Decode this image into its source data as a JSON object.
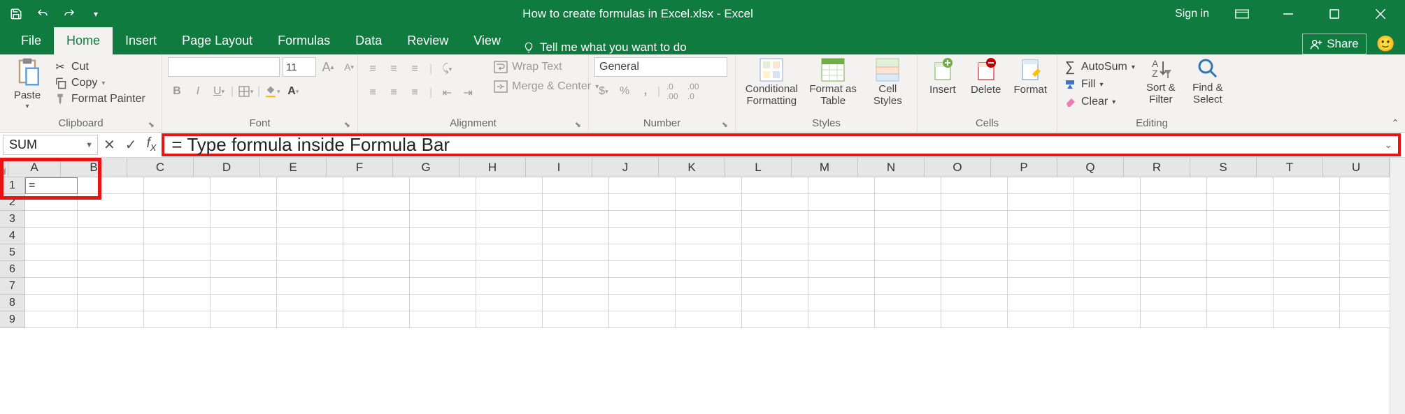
{
  "titlebar": {
    "title": "How to create formulas in Excel.xlsx - Excel",
    "signin": "Sign in"
  },
  "tabs": {
    "file": "File",
    "home": "Home",
    "insert": "Insert",
    "page_layout": "Page Layout",
    "formulas": "Formulas",
    "data": "Data",
    "review": "Review",
    "view": "View",
    "tell_me": "Tell me what you want to do",
    "share": "Share"
  },
  "ribbon": {
    "clipboard": {
      "label": "Clipboard",
      "paste": "Paste",
      "cut": "Cut",
      "copy": "Copy",
      "format_painter": "Format Painter"
    },
    "font": {
      "label": "Font",
      "font_name": "",
      "font_size": "11"
    },
    "alignment": {
      "label": "Alignment",
      "wrap": "Wrap Text",
      "merge": "Merge & Center"
    },
    "number": {
      "label": "Number",
      "format": "General"
    },
    "styles": {
      "label": "Styles",
      "conditional": "Conditional\nFormatting",
      "format_as": "Format as\nTable",
      "cell_styles": "Cell\nStyles"
    },
    "cells": {
      "label": "Cells",
      "insert": "Insert",
      "delete": "Delete",
      "format": "Format"
    },
    "editing": {
      "label": "Editing",
      "autosum": "AutoSum",
      "fill": "Fill",
      "clear": "Clear",
      "sort": "Sort &\nFilter",
      "find": "Find &\nSelect"
    }
  },
  "formula_bar": {
    "name_box": "SUM",
    "formula": "= Type formula inside Formula Bar"
  },
  "grid": {
    "columns": [
      "A",
      "B",
      "C",
      "D",
      "E",
      "F",
      "G",
      "H",
      "I",
      "J",
      "K",
      "L",
      "M",
      "N",
      "O",
      "P",
      "Q",
      "R",
      "S",
      "T",
      "U"
    ],
    "rows": [
      "1",
      "2",
      "3",
      "4",
      "5",
      "6",
      "7",
      "8",
      "9"
    ],
    "a1_value": "="
  }
}
